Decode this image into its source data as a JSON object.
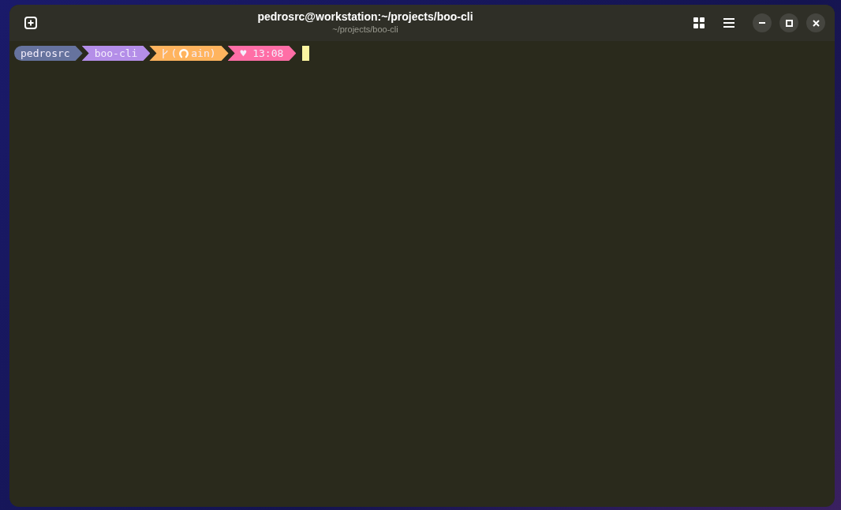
{
  "window": {
    "title": "pedrosrc@workstation:~/projects/boo-cli",
    "subtitle": "~/projects/boo-cli"
  },
  "prompt": [
    {
      "kind": "user",
      "text": "pedrosrc",
      "color": "#66739e"
    },
    {
      "kind": "dir",
      "text": "boo-cli",
      "color": "#b48ee8"
    },
    {
      "kind": "git",
      "prefix": "(",
      "suffix": "ain)",
      "color": "#ffb45e"
    },
    {
      "kind": "time",
      "text": "♥ 13:08",
      "color": "#ff6ea6"
    }
  ]
}
